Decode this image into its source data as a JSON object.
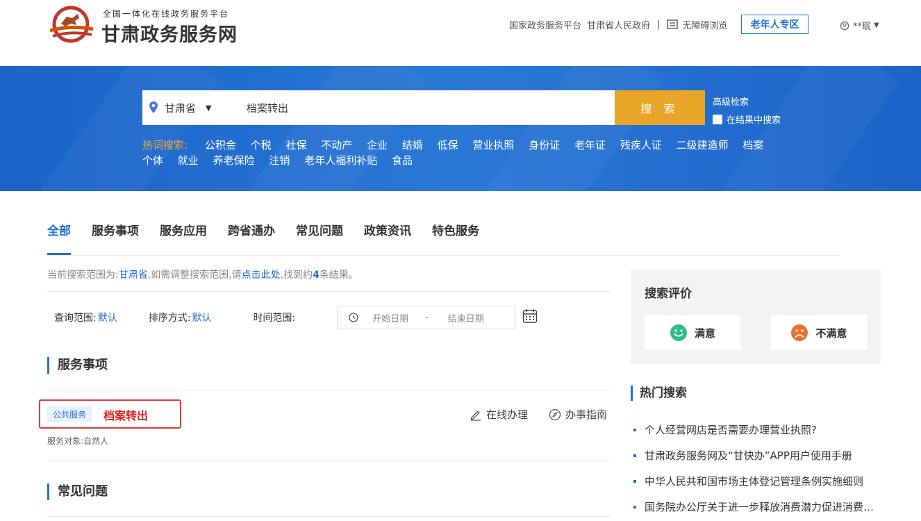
{
  "header": {
    "logo_subtitle": "全国一体化在线政务服务平台",
    "logo_title": "甘肃政务服务网",
    "links": [
      "国家政务服务平台",
      "甘肃省人民政府"
    ],
    "separator": "|",
    "accessibility": "无障碍浏览",
    "elder_zone": "老年人专区",
    "user": "**珉"
  },
  "search": {
    "region": "甘肃省",
    "query": "档案转出",
    "button": "搜 索",
    "advanced": "高级检索",
    "in_results": "在结果中搜索",
    "hot_label": "热词搜索:",
    "hot_keywords": [
      "公积金",
      "个税",
      "社保",
      "不动产",
      "企业",
      "结婚",
      "低保",
      "营业执照",
      "身份证",
      "老年证",
      "残疾人证",
      "二级建造师",
      "档案",
      "个体",
      "就业",
      "养老保险",
      "注销",
      "老年人福利补贴",
      "食品"
    ]
  },
  "tabs": [
    {
      "label": "全部",
      "active": true
    },
    {
      "label": "服务事项",
      "active": false
    },
    {
      "label": "服务应用",
      "active": false
    },
    {
      "label": "跨省通办",
      "active": false
    },
    {
      "label": "常见问题",
      "active": false
    },
    {
      "label": "政策资讯",
      "active": false
    },
    {
      "label": "特色服务",
      "active": false
    }
  ],
  "scope": {
    "prefix": "当前搜索范围为:",
    "region": "甘肃省",
    "mid": ",如需调整搜索范围,请",
    "link": "点击此处",
    "found_prefix": ",找到约",
    "count": "4",
    "found_suffix": "条结果。"
  },
  "filters": {
    "query_range_label": "查询范围:",
    "query_range_value": "默认",
    "sort_label": "排序方式:",
    "sort_value": "默认",
    "time_label": "时间范围:",
    "start_placeholder": "开始日期",
    "dash": "-",
    "end_placeholder": "结束日期"
  },
  "sections": {
    "services_title": "服务事项",
    "faq_title": "常见问题"
  },
  "result": {
    "tag": "公共服务",
    "title": "档案转出",
    "meta": "服务对象:自然人",
    "action_online": "在线办理",
    "action_guide": "办事指南"
  },
  "evaluation": {
    "title": "搜索评价",
    "satisfied": "满意",
    "unsatisfied": "不满意"
  },
  "hot_side": {
    "title": "热门搜索",
    "items": [
      "个人经营网店是否需要办理营业执照?",
      "甘肃政务服务网及“甘快办”APP用户使用手册",
      "中华人民共和国市场主体登记管理条例实施细则",
      "国务院办公厅关于进一步释放消费潜力促进消费持续恢复的意见"
    ]
  },
  "colors": {
    "primary": "#1f6fd1",
    "banner": "#2a78d6",
    "search_button": "#e8a628",
    "hot_label": "#f2a93b",
    "highlight": "#e02020",
    "satisfied": "#2ebd8e",
    "unsatisfied": "#f07030"
  }
}
